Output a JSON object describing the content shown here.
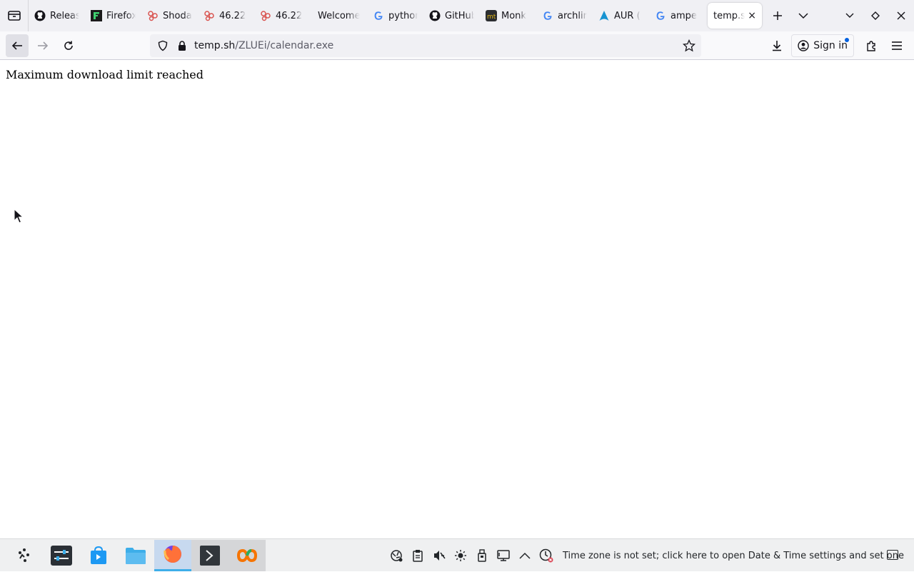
{
  "browser": {
    "tabs": [
      {
        "label": "Releases",
        "icon": "github-icon"
      },
      {
        "label": "Firefox",
        "icon": "firefox-tab-icon"
      },
      {
        "label": "Shodan",
        "icon": "shodan-icon"
      },
      {
        "label": "46.22",
        "icon": "shodan-icon"
      },
      {
        "label": "46.22",
        "icon": "shodan-icon"
      },
      {
        "label": "Welcome",
        "icon": "none"
      },
      {
        "label": "python",
        "icon": "google-icon"
      },
      {
        "label": "GitHub",
        "icon": "github-icon"
      },
      {
        "label": "Monk",
        "icon": "monkeytype-icon"
      },
      {
        "label": "archlinux",
        "icon": "google-icon"
      },
      {
        "label": "AUR (",
        "icon": "arch-icon"
      },
      {
        "label": "ampe",
        "icon": "google-icon"
      }
    ],
    "active_tab": {
      "label": "temp.sh",
      "close": "×"
    },
    "url_host": "temp.sh",
    "url_path": "/ZLUEi/calendar.exe",
    "signin_label": "Sign in"
  },
  "page": {
    "message": "Maximum download limit reached"
  },
  "taskbar": {
    "tray_message": "Time zone is not set; click here to open Date & Time settings and set one"
  },
  "colors": {
    "tabstrip_bg": "#f0f0f4",
    "accent": "#0060df",
    "taskbar_active": "#3daee9"
  }
}
